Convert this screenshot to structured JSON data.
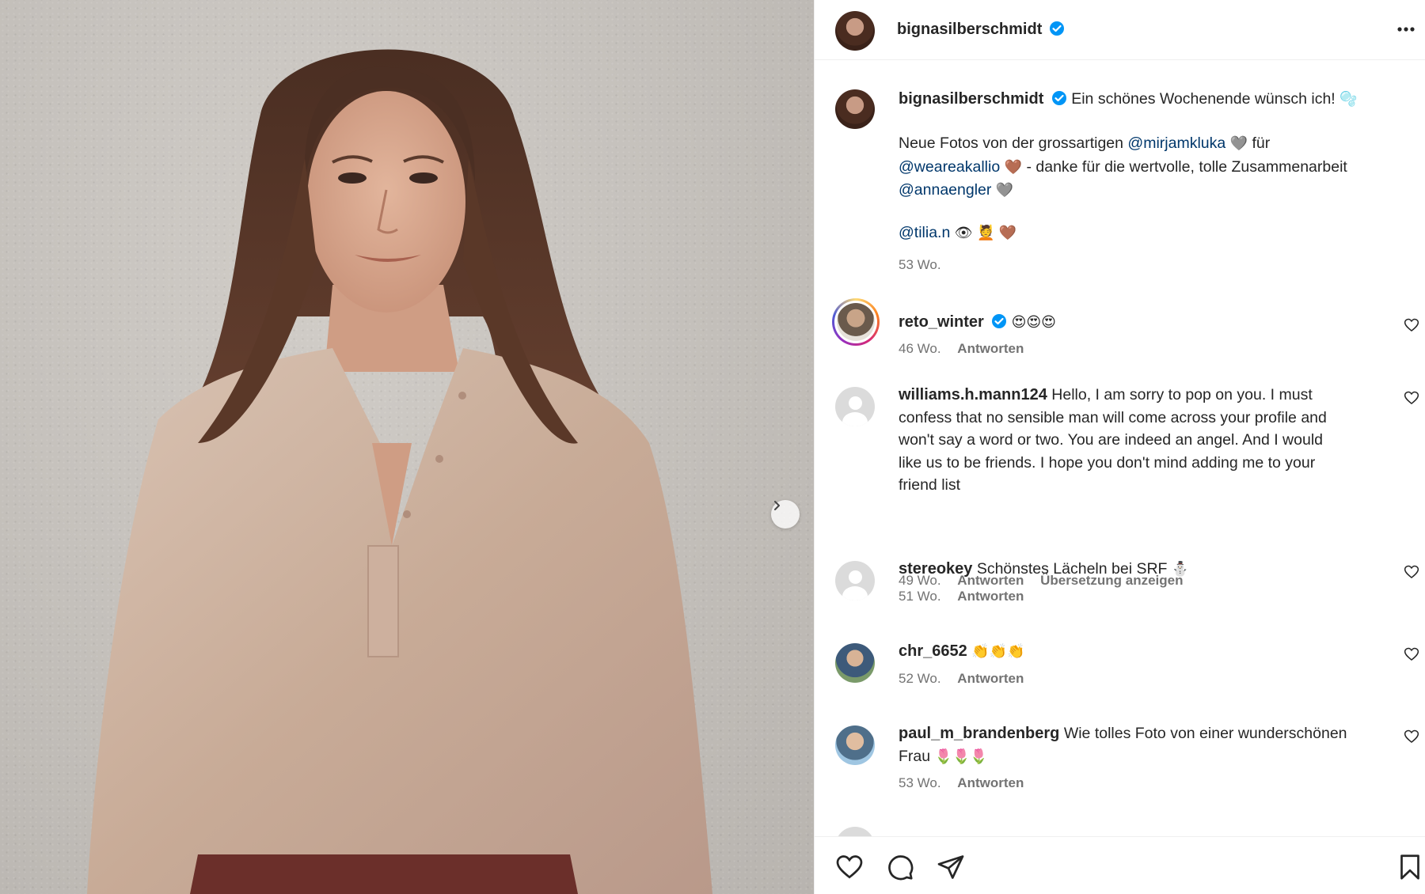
{
  "post": {
    "owner": "bignasilberschmidt",
    "more_icon": "more-horizontal-icon",
    "caption": {
      "line1": "Ein schönes Wochenende wünsch ich!",
      "line2_a": "Neue Fotos von der grossartigen",
      "mention_photographer": "@mirjamkluka",
      "line2_b": "für",
      "mention_brand": "@weareakallio",
      "line3_b": "- danke für die wertvolle, tolle Zusammenarbeit",
      "mention_stylist": "@annaengler",
      "mention_makeup": "@tilia.n",
      "time": "53 Wo."
    },
    "colors": {
      "mention": "#00376b",
      "verified": "#0095f6",
      "meta": "#737373"
    }
  },
  "comments": [
    {
      "user": "reto_winter",
      "text": "😍😍😍",
      "time": "46 Wo.",
      "reply": "Antworten",
      "verified": true
    },
    {
      "user": "williams.h.mann124",
      "text": "Hello, I am sorry to pop on you. I must confess that no sensible man will come across your profile and won't say a word or two. You are indeed an angel. And I would like us to be friends. I hope you don't mind adding me to your friend list",
      "time": "49 Wo.",
      "reply": "Antworten",
      "translate": "Übersetzung anzeigen"
    },
    {
      "user": "stereokey",
      "text": "Schönstes Lächeln bei SRF",
      "time": "51 Wo.",
      "reply": "Antworten"
    },
    {
      "user": "chr_6652",
      "text": "👏👏👏",
      "time": "52 Wo.",
      "reply": "Antworten"
    },
    {
      "user": "paul_m_brandenberg",
      "text": "Wie tolles Foto von einer wunderschönen Frau",
      "time": "53 Wo.",
      "reply": "Antworten"
    }
  ],
  "actions": {
    "like_icon": "heart-icon",
    "comment_icon": "comment-icon",
    "share_icon": "send-icon",
    "save_icon": "bookmark-icon"
  }
}
